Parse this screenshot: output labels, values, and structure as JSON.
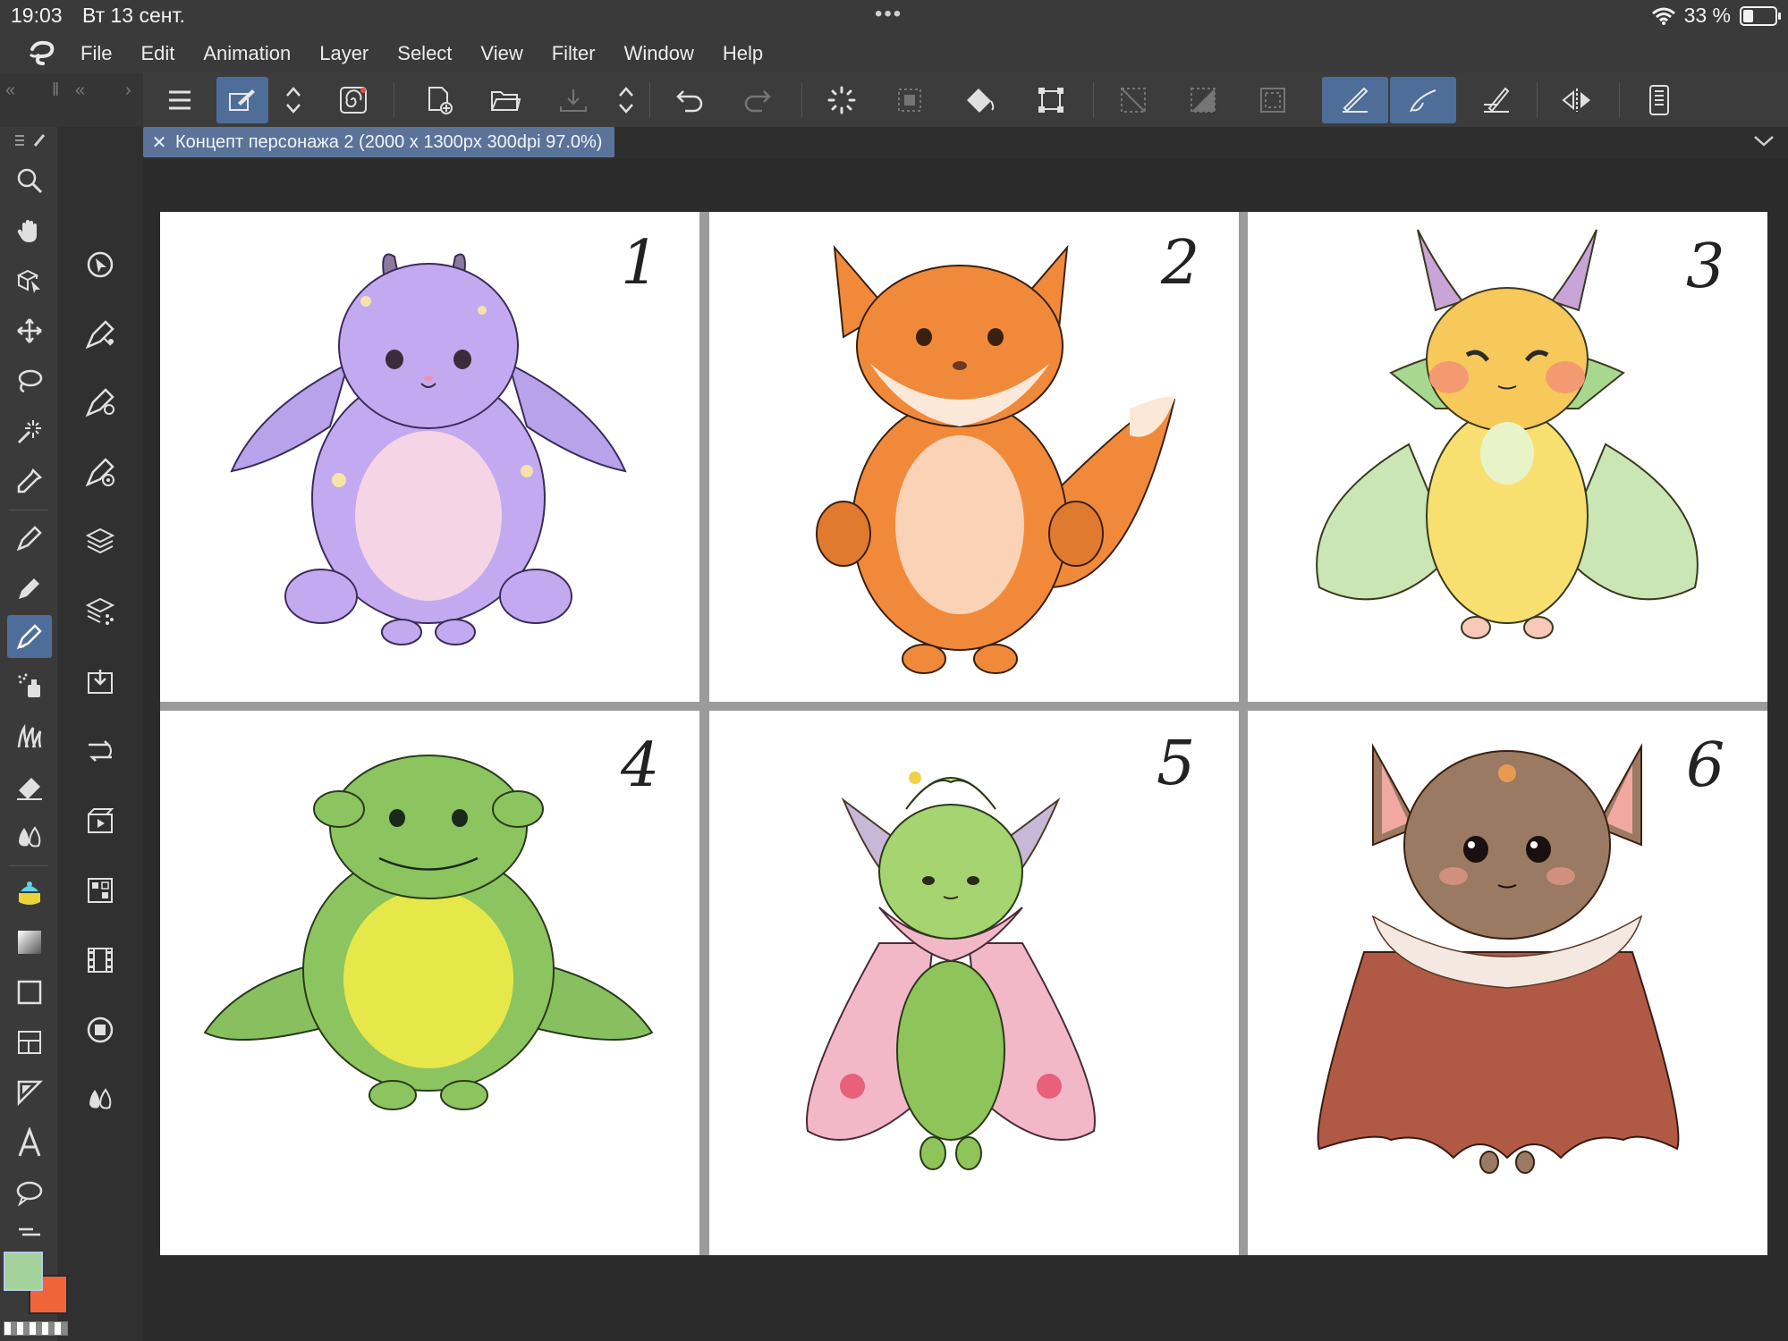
{
  "status": {
    "time": "19:03",
    "date": "Вт 13 сент.",
    "dots": "•••",
    "battery_text": "33 %",
    "battery_level": 0.33
  },
  "menu": [
    "File",
    "Edit",
    "Animation",
    "Layer",
    "Select",
    "View",
    "Filter",
    "Window",
    "Help"
  ],
  "toolbar_icons": [
    "menu-icon",
    "toggle-pen-mode-icon",
    "up-down-icon",
    "pressure-spiral-icon",
    "new-canvas-icon",
    "open-folder-icon",
    "save-icon",
    "up-down-icon",
    "undo-icon",
    "redo-icon",
    "marching-ants-icon",
    "selection-area-icon",
    "fill-bucket-icon",
    "transform-icon",
    "deselect-icon",
    "invert-selection-icon",
    "selection-border-icon",
    "pen-stabilizer-icon",
    "brush-curve-icon",
    "ruler-snap-icon",
    "flip-horizontal-icon",
    "device-icon"
  ],
  "document": {
    "tab_title": "Концепт персонажа 2 (2000 x 1300px 300dpi 97.0%)",
    "close_glyph": "✕"
  },
  "panels": [
    {
      "number": "1",
      "character": "purple-bunny-creature"
    },
    {
      "number": "2",
      "character": "orange-fox-creature"
    },
    {
      "number": "3",
      "character": "yellow-moth-creature"
    },
    {
      "number": "4",
      "character": "green-frog-creature"
    },
    {
      "number": "5",
      "character": "leaf-fairy-creature"
    },
    {
      "number": "6",
      "character": "brown-bat-creature"
    }
  ],
  "colors": {
    "main": "#a3d39a",
    "sub": "#f0643a",
    "accent": "#4e6e99"
  }
}
